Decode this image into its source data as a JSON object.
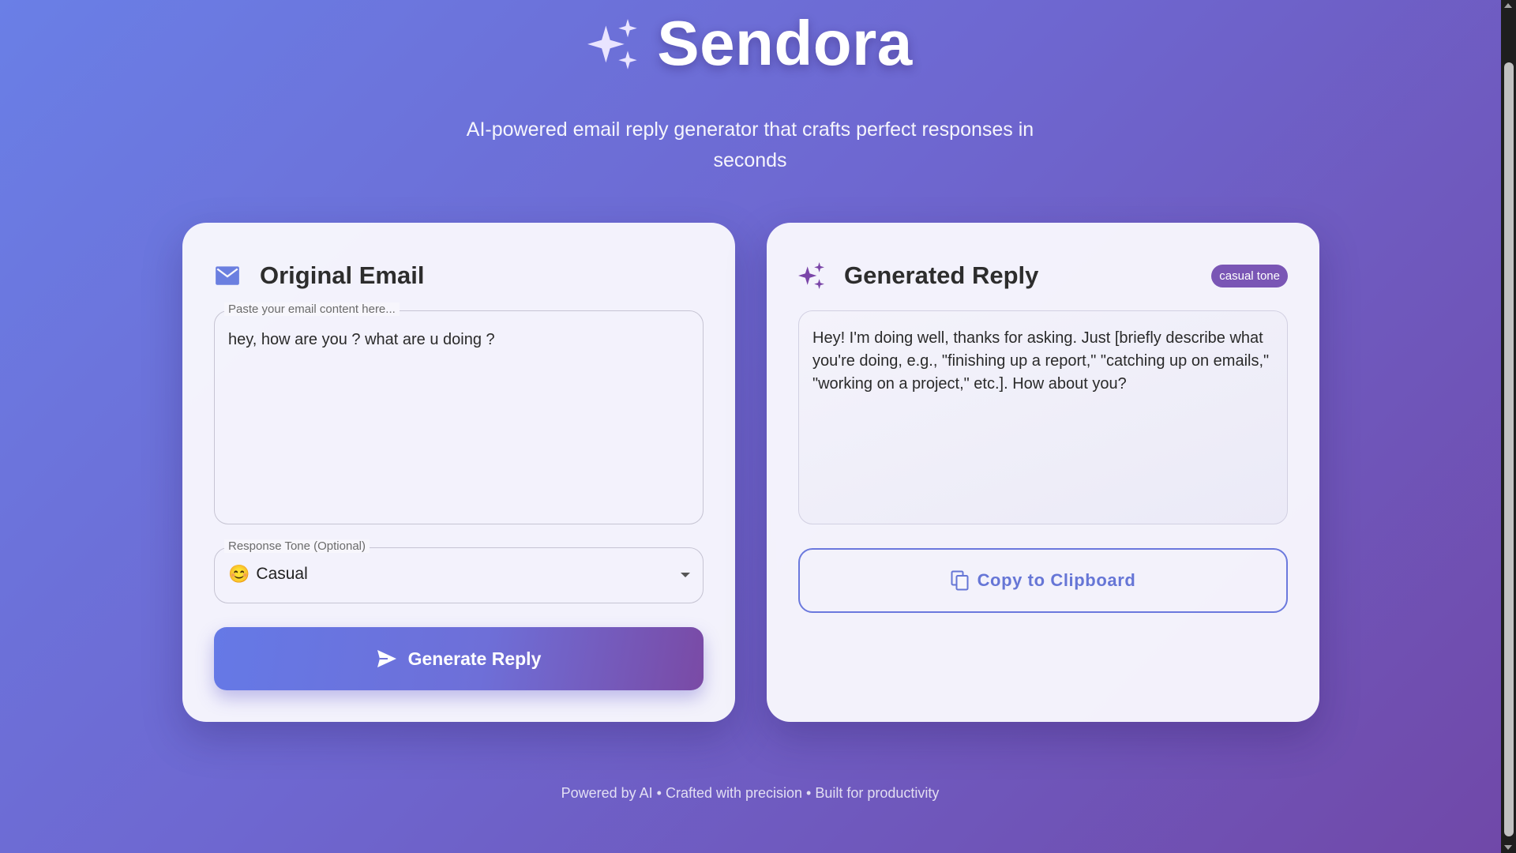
{
  "brand": {
    "icon": "sparkles-icon",
    "title": "Sendora",
    "tagline": "AI-powered email reply generator that crafts perfect responses in seconds"
  },
  "original": {
    "icon": "mail-icon",
    "title": "Original Email",
    "email_label": "Paste your email content here...",
    "email_value": "hey, how are you ? what are u doing ?",
    "tone_label": "Response Tone (Optional)",
    "tone_emoji": "😊",
    "tone_value": "Casual",
    "generate_icon": "send-icon",
    "generate_label": "Generate Reply"
  },
  "reply": {
    "icon": "sparkles-icon",
    "title": "Generated Reply",
    "badge": "casual tone",
    "text": "Hey! I'm doing well, thanks for asking.  Just [briefly describe what you're doing, e.g.,  \"finishing up a report,\" \"catching up on emails,\" \"working on a project,\" etc.]. How about you?",
    "copy_icon": "copy-icon",
    "copy_label": "Copy to Clipboard"
  },
  "footer": {
    "text": "Powered by AI • Crafted with precision • Built for productivity"
  },
  "colors": {
    "accent": "#6676d6",
    "badge": "#7a56b5",
    "gradient_start": "#6a7fe6",
    "gradient_end": "#7048a8"
  }
}
